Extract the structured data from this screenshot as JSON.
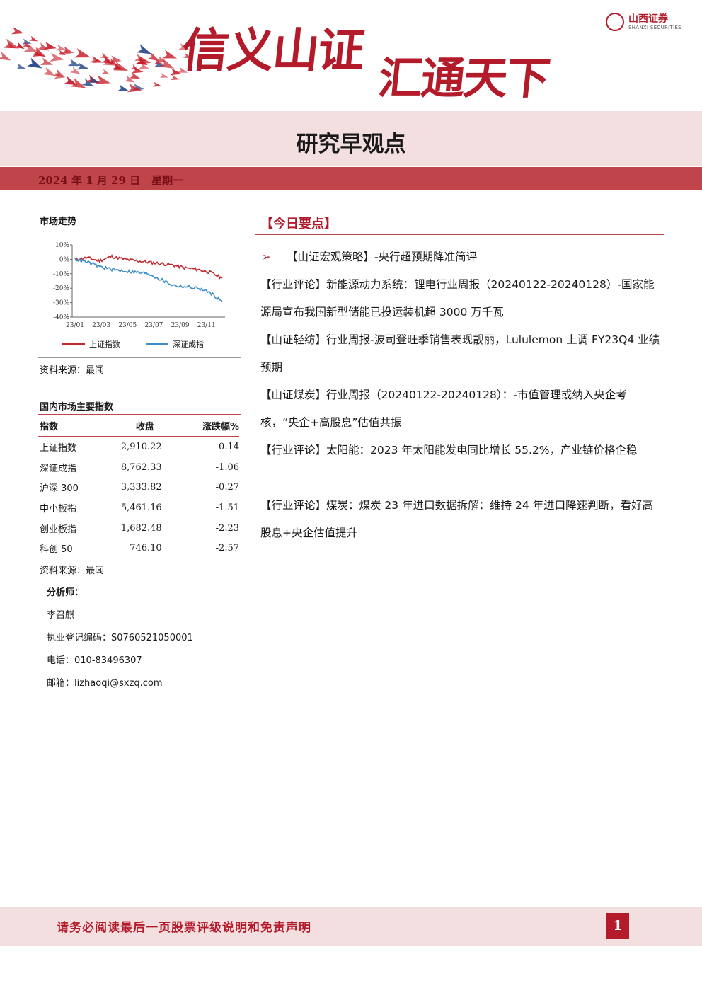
{
  "header": {
    "slogan_part1": "信义山证",
    "slogan_part2": "汇通天下",
    "logo_name": "山西证券",
    "logo_sub": "SHANXI SECURITIES",
    "report_title": "研究早观点",
    "date": "2024 年 1 月 29 日",
    "weekday": "星期一",
    "brand_color": "#b31b2a"
  },
  "sidebar": {
    "market_trend_heading": "市场走势",
    "chart_source": "资料来源：最闻",
    "indices_heading": "国内市场主要指数",
    "table_headers": [
      "指数",
      "收盘",
      "涨跌幅%"
    ],
    "rows": [
      {
        "name": "上证指数",
        "close": "2,910.22",
        "change": "0.14"
      },
      {
        "name": "深证成指",
        "close": "8,762.33",
        "change": "-1.06"
      },
      {
        "name": "沪深 300",
        "close": "3,333.82",
        "change": "-0.27"
      },
      {
        "name": "中小板指",
        "close": "5,461.16",
        "change": "-1.51"
      },
      {
        "name": "创业板指",
        "close": "1,682.48",
        "change": "-2.23"
      },
      {
        "name": "科创 50",
        "close": "746.10",
        "change": "-2.57"
      }
    ],
    "table_source": "资料来源：最闻",
    "analyst_heading": "分析师：",
    "analyst_name": "李召麒",
    "license": "执业登记编码：S0760521050001",
    "phone": "电话：010-83496307",
    "email": "邮箱：lizhaoqi@sxzq.com"
  },
  "chart_data": {
    "type": "line",
    "title": "",
    "xlabel": "",
    "ylabel": "",
    "x_ticks": [
      "23/01",
      "23/03",
      "23/05",
      "23/07",
      "23/09",
      "23/11"
    ],
    "y_ticks": [
      "10%",
      "0%",
      "-10%",
      "-20%",
      "-30%",
      "-40%"
    ],
    "ylim": [
      -40,
      10
    ],
    "x": [
      0,
      1,
      2,
      3,
      4,
      5,
      6,
      7,
      8,
      9,
      10,
      11,
      12
    ],
    "series": [
      {
        "name": "上证指数",
        "color": "#c0262d",
        "values": [
          0,
          1,
          -1,
          2,
          0,
          -1,
          -2,
          -3,
          -4,
          -6,
          -7,
          -9,
          -13
        ]
      },
      {
        "name": "深证成指",
        "color": "#3a8fc9",
        "values": [
          0,
          -2,
          -5,
          -7,
          -8,
          -9,
          -10,
          -14,
          -18,
          -19,
          -20,
          -23,
          -29
        ]
      }
    ],
    "legend_position": "bottom",
    "grid": false
  },
  "main": {
    "heading": "【今日要点】",
    "items": [
      {
        "marker": "➢",
        "text": "【山证宏观策略】-央行超预期降准简评"
      },
      {
        "marker": "",
        "text": "【行业评论】新能源动力系统：锂电行业周报（20240122-20240128）-国家能源局宣布我国新型储能已投运装机超 3000 万千瓦"
      },
      {
        "marker": "",
        "text": "【山证轻纺】行业周报-波司登旺季销售表现靓丽，Lululemon 上调 FY23Q4 业绩预期"
      },
      {
        "marker": "",
        "text": "【山证煤炭】行业周报（20240122-20240128）：-市值管理或纳入央企考核，“央企+高股息”估值共振"
      },
      {
        "marker": "",
        "text": "【行业评论】太阳能：2023 年太阳能发电同比增长 55.2%，产业链价格企稳"
      },
      {
        "marker": "",
        "text": "【行业评论】煤炭：煤炭 23 年进口数据拆解：维持 24 年进口降速判断，看好高股息+央企估值提升"
      }
    ]
  },
  "footer": {
    "disclaimer": "请务必阅读最后一页股票评级说明和免责声明",
    "page_number": "1"
  }
}
